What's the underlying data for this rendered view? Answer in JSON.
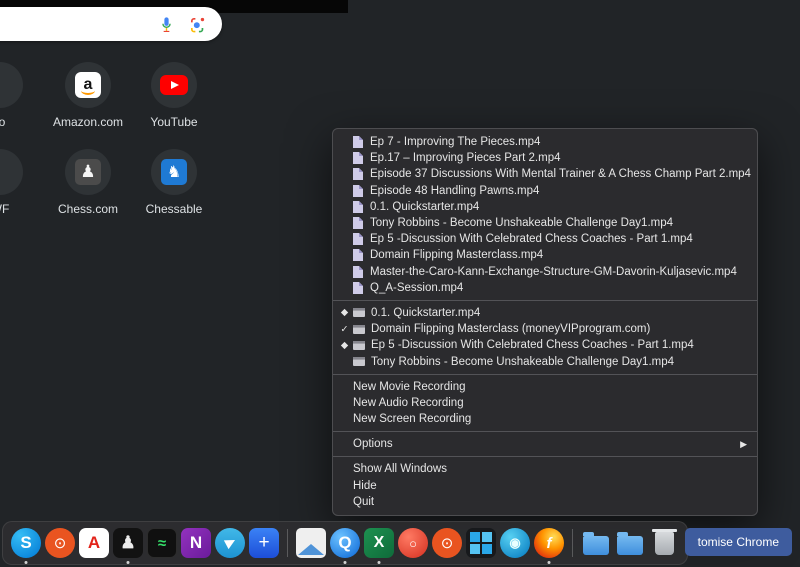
{
  "colors": {
    "background": "#212427",
    "menu_background": "#2b2b2e",
    "menu_text": "#e6e6e6",
    "dock_background": "#2e2e31",
    "customize_button_blue": "#3e5c9e",
    "youtube_red": "#ff0000",
    "amazon_orange": "#ff9900",
    "chessable_blue": "#1f7ad4"
  },
  "search_bar": {
    "value": "",
    "icons": [
      {
        "name": "mic-icon"
      },
      {
        "name": "lens-icon"
      }
    ]
  },
  "shortcuts": [
    {
      "label": "ro",
      "glyph": "",
      "partial": true
    },
    {
      "label": "Amazon.com",
      "glyph": "a"
    },
    {
      "label": "YouTube",
      "glyph": ""
    },
    {
      "label": "WF",
      "glyph": "",
      "partial": true
    },
    {
      "label": "Chess.com",
      "glyph": "♟"
    },
    {
      "label": "Chessable",
      "glyph": "♞"
    }
  ],
  "menu": {
    "recent_files": [
      "Ep 7 - Improving The Pieces.mp4",
      "Ep.17 – Improving Pieces Part 2.mp4",
      "Episode 37 Discussions With Mental Trainer & A Chess Champ  Part 2.mp4",
      "Episode 48 Handling Pawns.mp4",
      "0.1. Quickstarter.mp4",
      "Tony Robbins - Become Unshakeable Challenge Day1.mp4",
      "Ep 5 -Discussion With Celebrated Chess Coaches - Part 1.mp4",
      "Domain Flipping Masterclass.mp4",
      "Master-the-Caro-Kann-Exchange-Structure-GM-Davorin-Kuljasevic.mp4",
      "Q_A-Session.mp4"
    ],
    "windows": [
      {
        "marker": "◆",
        "label": "0.1. Quickstarter.mp4"
      },
      {
        "marker": "✓",
        "label": "Domain Flipping Masterclass (moneyVIPprogram.com)"
      },
      {
        "marker": "◆",
        "label": "Ep 5 -Discussion With Celebrated Chess Coaches - Part 1.mp4"
      },
      {
        "marker": "",
        "label": "Tony Robbins - Become Unshakeable Challenge Day1.mp4"
      }
    ],
    "actions": [
      "New Movie Recording",
      "New Audio Recording",
      "New Screen Recording"
    ],
    "options_label": "Options",
    "submenu_arrow": "▶",
    "app_items": [
      "Show All Windows",
      "Hide",
      "Quit"
    ]
  },
  "dock": {
    "items": [
      {
        "name": "skype-icon",
        "glyph": "S"
      },
      {
        "name": "ubuntu-icon",
        "glyph": "⊙"
      },
      {
        "name": "acrobat-reader-icon",
        "glyph": "A"
      },
      {
        "name": "chess-app-icon",
        "glyph": "♟"
      },
      {
        "name": "audio-scope-icon",
        "glyph": "≈"
      },
      {
        "name": "onenote-icon",
        "glyph": "N"
      },
      {
        "name": "telegram-icon",
        "glyph": "▶"
      },
      {
        "name": "app-add-icon",
        "glyph": "+"
      },
      {
        "name": "screenshot-preview-icon",
        "glyph": ""
      },
      {
        "name": "quicktime-icon",
        "glyph": "Q"
      },
      {
        "name": "excel-icon",
        "glyph": "X"
      },
      {
        "name": "red-circle-app-icon",
        "glyph": "○"
      },
      {
        "name": "ubuntu2-icon",
        "glyph": "⊙"
      },
      {
        "name": "windows-icon",
        "glyph": ""
      },
      {
        "name": "media-player-icon",
        "glyph": "◉"
      },
      {
        "name": "firefox-icon",
        "glyph": "f"
      },
      {
        "name": "folder-icon-1",
        "glyph": ""
      },
      {
        "name": "folder-icon-2",
        "glyph": ""
      },
      {
        "name": "trash-icon",
        "glyph": ""
      }
    ]
  },
  "customize_button": {
    "label": "tomise Chrome"
  }
}
